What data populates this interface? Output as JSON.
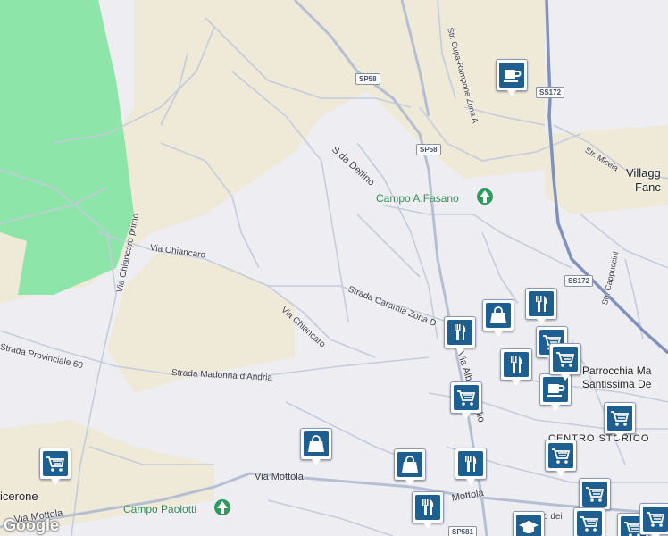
{
  "map": {
    "colors": {
      "background": "#eeeef2",
      "green": "#8ee5a9",
      "beige": "#efe9d8",
      "road": "#c4ccdc",
      "highway": "#7f92bd",
      "marker_fill": "#1f5f8f"
    },
    "roads": {
      "via_chiancaro": "Via Chiancaro",
      "via_chiancaro_2": "Via Chiancaro",
      "via_chiancaro_primo": "Via Chiancaro primo",
      "strada_provinciale_60": "Strada Provinciale 60",
      "strada_madonna_dandria": "Strada Madonna d'Andria",
      "strada_caramia_zona": "Strada Caramia Zona D",
      "via_mottola": "Via Mottola",
      "via_mottola_2": "Via Mottola",
      "via_mottola_3": "Mottola",
      "s_da_delfino": "S.da Delfino",
      "str_cupa_rampone": "Str. Cupa-Rampone Zona A",
      "str_micela": "Str. Micela",
      "str_cappuccini": "Str. Cappuccini",
      "via_alb": "Via Alb",
      "via_llo": "llo",
      "via_dei": "o dei"
    },
    "shields": {
      "sp58_top": "SP58",
      "sp58_mid": "SP58",
      "ss172_top": "SS172",
      "ss172_bottom": "SS172",
      "sp581": "SP581"
    },
    "places": {
      "villaggio_1": "Villagg",
      "villaggio_2": "Fanc",
      "centro_storico": "CENTRO STORICO",
      "cicerone": "icerone",
      "parrocchia_1": "Parrocchia Ma",
      "parrocchia_2": "Santissima De"
    },
    "parks": {
      "campo_fasano": "Campo A.Fasano",
      "campo_paolotti": "Campo Paolotti"
    },
    "markers": [
      {
        "type": "cafe-icon"
      },
      {
        "type": "restaurant-icon"
      },
      {
        "type": "shopping-bag-icon"
      },
      {
        "type": "restaurant-icon"
      },
      {
        "type": "restaurant-icon"
      },
      {
        "type": "cafe-icon"
      },
      {
        "type": "cart-icon"
      },
      {
        "type": "cart-icon"
      },
      {
        "type": "shopping-bag-icon"
      },
      {
        "type": "cart-icon"
      },
      {
        "type": "cart-icon"
      },
      {
        "type": "restaurant-icon"
      },
      {
        "type": "shopping-bag-icon"
      },
      {
        "type": "cart-icon"
      },
      {
        "type": "restaurant-icon"
      },
      {
        "type": "cart-icon"
      },
      {
        "type": "cart-icon"
      },
      {
        "type": "graduation-cap-icon"
      },
      {
        "type": "cart-icon"
      },
      {
        "type": "cart-icon"
      },
      {
        "type": "cart-icon"
      }
    ],
    "attribution": "Google"
  }
}
